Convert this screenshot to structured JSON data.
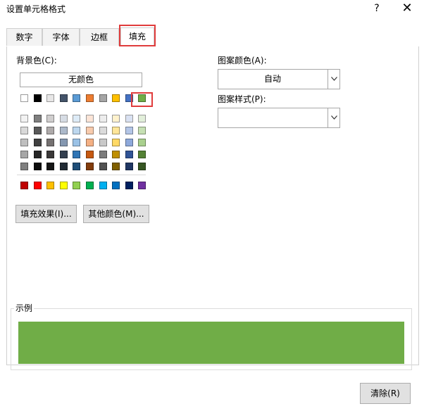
{
  "window": {
    "title": "设置单元格格式",
    "help_label": "?",
    "close_label": "✕"
  },
  "tabs": [
    {
      "label": "数字",
      "active": false
    },
    {
      "label": "字体",
      "active": false
    },
    {
      "label": "边框",
      "active": false
    },
    {
      "label": "填充",
      "active": true
    }
  ],
  "fill": {
    "background_label": "背景色(C):",
    "no_color_label": "无颜色",
    "fill_effects_label": "填充效果(I)...",
    "more_colors_label": "其他颜色(M)...",
    "pattern_color_label": "图案颜色(A):",
    "pattern_color_value": "自动",
    "pattern_style_label": "图案样式(P):",
    "pattern_style_value": "",
    "selected_color": "#70AD47",
    "theme_rows": [
      [
        "#FFFFFF",
        "#000000",
        "#E7E6E6",
        "#44546A",
        "#5B9BD5",
        "#ED7D31",
        "#A5A5A5",
        "#FFC000",
        "#4472C4",
        "#70AD47"
      ],
      [
        "#F2F2F2",
        "#7F7F7F",
        "#D0CECE",
        "#D6DCE4",
        "#DDEBF7",
        "#FCE4D6",
        "#EDEDED",
        "#FFF2CC",
        "#D9E1F2",
        "#E2EFDA"
      ],
      [
        "#D9D9D9",
        "#595959",
        "#AEAAAA",
        "#ACB9CA",
        "#BDD7EE",
        "#F8CBAD",
        "#DBDBDB",
        "#FFE699",
        "#B4C6E7",
        "#C6E0B4"
      ],
      [
        "#BFBFBF",
        "#404040",
        "#757171",
        "#8497B0",
        "#9BC2E6",
        "#F4B084",
        "#C9C9C9",
        "#FFD966",
        "#8EA9DB",
        "#A9D08E"
      ],
      [
        "#A6A6A6",
        "#262626",
        "#3A3838",
        "#333F4F",
        "#2F75B5",
        "#C65911",
        "#7B7B7B",
        "#BF8F00",
        "#305496",
        "#548235"
      ],
      [
        "#808080",
        "#0D0D0D",
        "#161616",
        "#222B35",
        "#1F4E78",
        "#833C0C",
        "#525252",
        "#806000",
        "#203764",
        "#375623"
      ]
    ],
    "standard_colors": [
      "#C00000",
      "#FF0000",
      "#FFC000",
      "#FFFF00",
      "#92D050",
      "#00B050",
      "#00B0F0",
      "#0070C0",
      "#002060",
      "#7030A0"
    ]
  },
  "sample": {
    "label": "示例",
    "color": "#70AD47"
  },
  "footer": {
    "clear_label": "清除(R)"
  }
}
